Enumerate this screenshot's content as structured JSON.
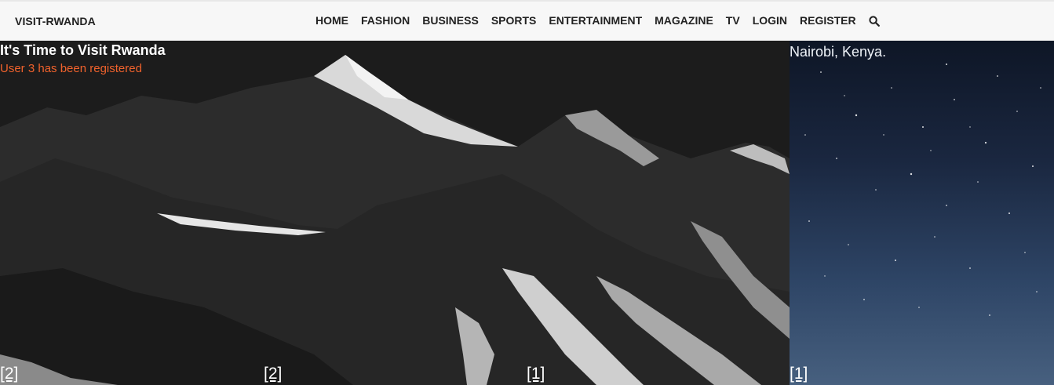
{
  "header": {
    "brand": "VISIT-RWANDA",
    "nav_items": [
      {
        "label": "HOME"
      },
      {
        "label": "FASHION"
      },
      {
        "label": "BUSINESS"
      },
      {
        "label": "SPORTS"
      },
      {
        "label": "ENTERTAINMENT"
      },
      {
        "label": "MAGAZINE"
      },
      {
        "label": "TV"
      },
      {
        "label": "LOGIN"
      },
      {
        "label": "REGISTER"
      }
    ],
    "search_icon": "search-icon"
  },
  "hero": {
    "title": "It's Time to Visit Rwanda",
    "status": "User 3 has been registered",
    "status_color": "#f0622c"
  },
  "side_panel": {
    "caption": "Nairobi, Kenya."
  },
  "counters": [
    "[2]",
    "[2]",
    "[1]",
    "[1]"
  ]
}
